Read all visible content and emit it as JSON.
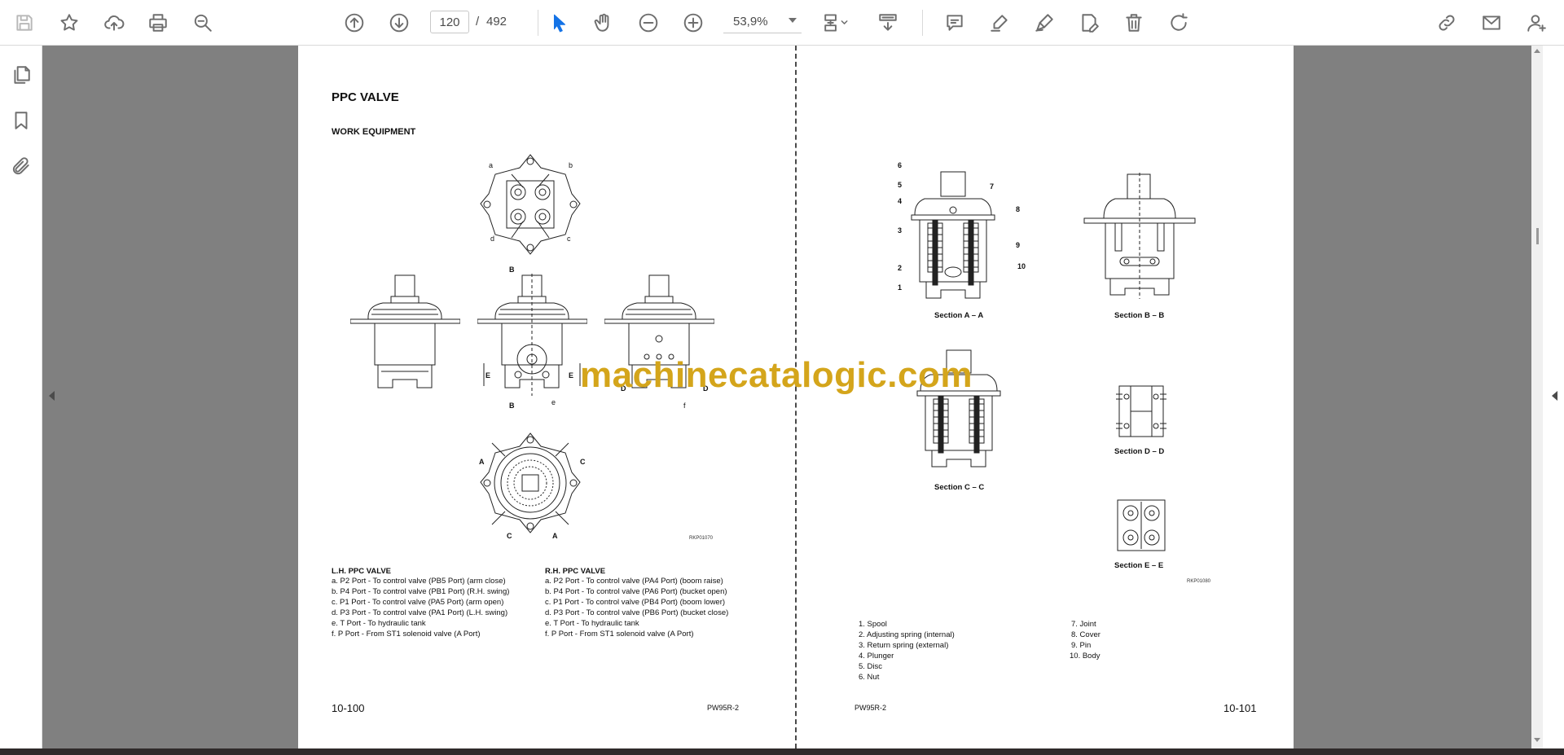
{
  "toolbar": {
    "page_current": "120",
    "page_separator": "/",
    "page_total": "492",
    "zoom": "53,9%",
    "icons": [
      "save-icon",
      "bookmark-star-icon",
      "upload-cloud-icon",
      "print-icon",
      "search-zoom-icon",
      "page-up-icon",
      "page-down-icon",
      "select-arrow-icon",
      "hand-icon",
      "zoom-out-icon",
      "zoom-in-icon",
      "fit-page-icon",
      "scroll-mode-icon",
      "comment-icon",
      "highlight-pen-icon",
      "draw-pen-icon",
      "fill-sign-icon",
      "delete-icon",
      "rotate-icon",
      "share-link-icon",
      "mail-icon",
      "account-icon"
    ]
  },
  "rail": {
    "icons": [
      "pages-icon",
      "bookmark-icon",
      "attachment-icon"
    ]
  },
  "watermark": "machinecatalogic.com",
  "left_page": {
    "title": "PPC VALVE",
    "subtitle": "WORK EQUIPMENT",
    "port_letters": {
      "a": "a",
      "b": "b",
      "c": "c",
      "d": "d",
      "e": "e",
      "f": "f"
    },
    "section_marks": {
      "A": "A",
      "B": "B",
      "C": "C",
      "D": "D",
      "E": "E"
    },
    "drawing_code": "RKP01070",
    "lh": {
      "heading": "L.H. PPC VALVE",
      "rows": [
        "a.  P2 Port  -   To control valve (PB5 Port) (arm close)",
        "b.  P4 Port  -   To control valve (PB1 Port) (R.H. swing)",
        "c.  P1 Port  -   To control valve (PA5 Port) (arm open)",
        "d.  P3 Port  -   To control valve (PA1 Port) (L.H. swing)",
        "e.  T Port     -   To hydraulic tank",
        "f.   P Port     -   From ST1 solenoid valve (A Port)"
      ]
    },
    "rh": {
      "heading": "R.H. PPC VALVE",
      "rows": [
        "a.  P2 Port  -   To control valve (PA4 Port) (boom raise)",
        "b.  P4 Port  -   To control valve (PA6 Port) (bucket open)",
        "c.  P1 Port  -   To control valve (PB4 Port) (boom lower)",
        "d.  P3 Port  -   To control valve (PB6 Port) (bucket close)",
        "e.  T Port     -   To hydraulic tank",
        "f.   P Port     -   From ST1 solenoid valve (A Port)"
      ]
    },
    "page_number": "10-100",
    "model": "PW95R-2"
  },
  "right_page": {
    "callouts": [
      "6",
      "5",
      "4",
      "3",
      "2",
      "1",
      "7",
      "8",
      "9",
      "10"
    ],
    "sections": {
      "aa": "Section A – A",
      "bb": "Section B – B",
      "cc": "Section C – C",
      "dd": "Section D – D",
      "ee": "Section E – E"
    },
    "drawing_code": "RKP01080",
    "parts_left": [
      "1.   Spool",
      "2.   Adjusting spring (internal)",
      "3.   Return spring (external)",
      "4.   Plunger",
      "5.   Disc",
      "6.   Nut"
    ],
    "parts_right": [
      "7.   Joint",
      "8.   Cover",
      "9.   Pin",
      "10.  Body"
    ],
    "model": "PW95R-2",
    "page_number": "10-101"
  }
}
